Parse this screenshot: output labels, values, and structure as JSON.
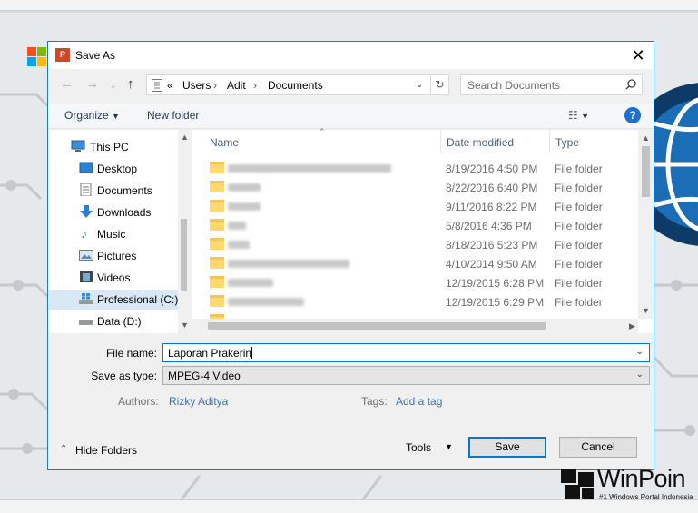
{
  "dialog": {
    "title": "Save As",
    "app_icon_letter": "P"
  },
  "address": {
    "crumbs": [
      "«",
      "Users",
      "Adit",
      "Documents"
    ]
  },
  "search": {
    "placeholder": "Search Documents"
  },
  "toolbar": {
    "organize_label": "Organize",
    "new_folder_label": "New folder",
    "help_label": "?"
  },
  "nav_pane": {
    "items": [
      {
        "label": "This PC",
        "icon": "computer-icon"
      },
      {
        "label": "Desktop",
        "icon": "desktop-icon"
      },
      {
        "label": "Documents",
        "icon": "documents-icon"
      },
      {
        "label": "Downloads",
        "icon": "downloads-icon"
      },
      {
        "label": "Music",
        "icon": "music-icon"
      },
      {
        "label": "Pictures",
        "icon": "pictures-icon"
      },
      {
        "label": "Videos",
        "icon": "videos-icon"
      },
      {
        "label": "Professional (C:)",
        "icon": "drive-icon"
      },
      {
        "label": "Data (D:)",
        "icon": "drive-icon"
      }
    ]
  },
  "file_list": {
    "columns": [
      "Name",
      "Date modified",
      "Type"
    ],
    "rows": [
      {
        "date": "8/19/2016 4:50 PM",
        "type": "File folder"
      },
      {
        "date": "8/22/2016 6:40 PM",
        "type": "File folder"
      },
      {
        "date": "9/11/2016 8:22 PM",
        "type": "File folder"
      },
      {
        "date": "5/8/2016 4:36 PM",
        "type": "File folder"
      },
      {
        "date": "8/18/2016 5:23 PM",
        "type": "File folder"
      },
      {
        "date": "4/10/2014 9:50 AM",
        "type": "File folder"
      },
      {
        "date": "12/19/2015 6:28 PM",
        "type": "File folder"
      },
      {
        "date": "12/19/2015 6:29 PM",
        "type": "File folder"
      }
    ]
  },
  "form": {
    "file_name_label": "File name:",
    "file_name_value": "Laporan Prakerin",
    "save_type_label": "Save as type:",
    "save_type_value": "MPEG-4 Video",
    "authors_label": "Authors:",
    "authors_value": "Rizky Aditya",
    "tags_label": "Tags:",
    "tags_value": "Add a tag"
  },
  "footer": {
    "hide_folders_label": "Hide Folders",
    "tools_label": "Tools",
    "save_label": "Save",
    "cancel_label": "Cancel"
  },
  "watermark": {
    "brand": "WinPoin",
    "tagline": "#1 Windows Portal Indonesia"
  },
  "colors": {
    "accent": "#0078d7",
    "dialog_border": "#1979ca",
    "folder": "#ffd86e",
    "link": "#3a73b8"
  }
}
